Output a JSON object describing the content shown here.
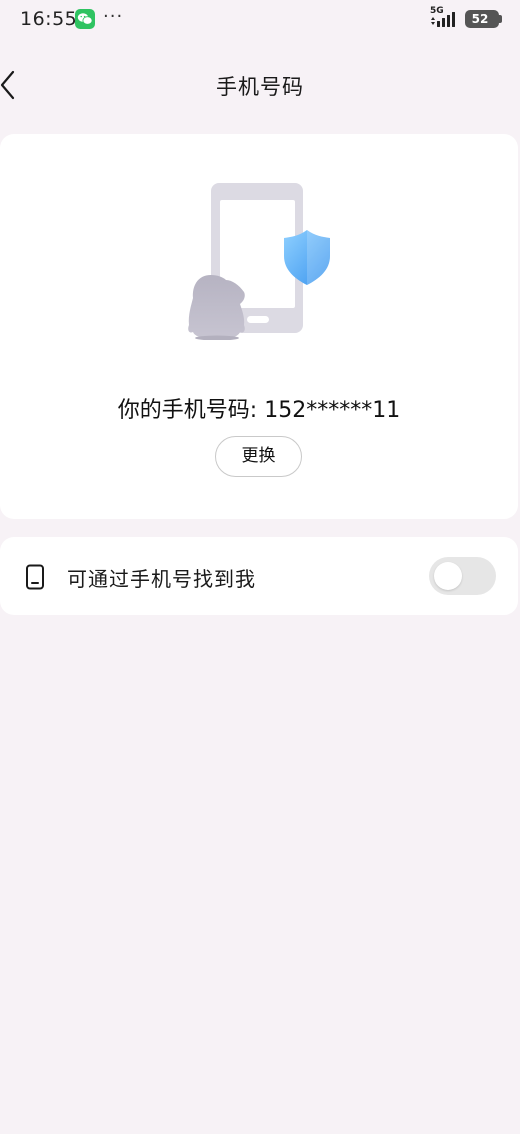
{
  "status_bar": {
    "time": "16:55",
    "more": "···",
    "network": "5G",
    "battery": "52",
    "app_icon": "wechat-icon"
  },
  "header": {
    "back_icon": "back-arrow-icon",
    "title": "手机号码"
  },
  "card": {
    "illustration_icon": "phone-security-illustration",
    "phone_text": "你的手机号码: 152******11",
    "change_label": "更换"
  },
  "settings": {
    "find_by_phone": {
      "icon": "mobile-phone-icon",
      "label": "可通过手机号找到我",
      "enabled": false
    }
  },
  "colors": {
    "background": "#f7f2f6",
    "card": "#ffffff",
    "shield": "#4aa8f5",
    "toggle_off": "#e6e6e6"
  }
}
